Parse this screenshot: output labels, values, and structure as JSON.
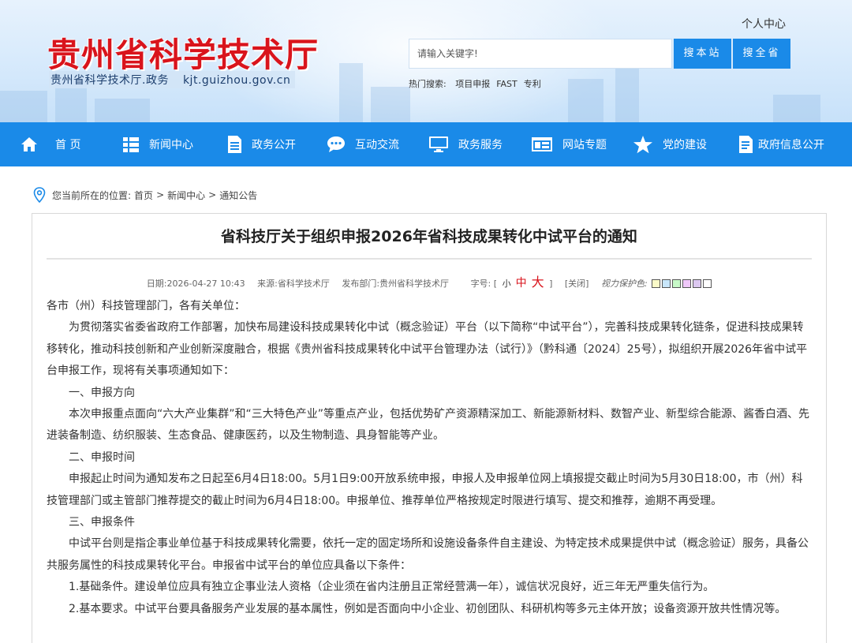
{
  "header": {
    "site_title": "贵州省科学技术厅",
    "site_subtitle_cn": "贵州省科学技术厅.政务",
    "site_subtitle_domain": "kjt.guizhou.gov.cn",
    "user_center": "个人中心",
    "search_placeholder": "请输入关键字!",
    "search_site_label": "搜本站",
    "search_province_label": "搜全省",
    "hot_label": "热门搜索:",
    "hot_items": [
      "项目申报",
      "FAST",
      "专利"
    ]
  },
  "nav": {
    "items": [
      {
        "label": "首 页",
        "icon": "home-icon"
      },
      {
        "label": "新闻中心",
        "icon": "grid-list-icon"
      },
      {
        "label": "政务公开",
        "icon": "document-icon"
      },
      {
        "label": "互动交流",
        "icon": "chat-bubble-icon"
      },
      {
        "label": "政务服务",
        "icon": "monitor-icon"
      },
      {
        "label": "网站专题",
        "icon": "window-icon"
      },
      {
        "label": "党的建设",
        "icon": "star-icon"
      },
      {
        "label": "政府信息公开",
        "icon": "file-icon"
      }
    ]
  },
  "breadcrumb": {
    "prefix": "您当前所在的位置:",
    "items": [
      "首页",
      "新闻中心",
      "通知公告"
    ],
    "separator": ">"
  },
  "article": {
    "title": "省科技厅关于组织申报2026年省科技成果转化中试平台的通知",
    "meta": {
      "date": "日期:2026-04-27 10:43",
      "source": "来源:省科学技术厅",
      "department": "发布部门:贵州省科学技术厅",
      "font_label": "字号:",
      "font_open": "[",
      "font_small": "小",
      "font_mid": "中",
      "font_big": "大",
      "font_close": "]",
      "close_label": "[关闭]",
      "eye_label": "视力保护色:",
      "swatch_colors": [
        "#fafac8",
        "#c8e6fa",
        "#c8fac8",
        "#f0c8fa",
        "#dcc8f0",
        "#ffffff"
      ]
    },
    "paragraphs": [
      "各市（州）科技管理部门，各有关单位：",
      "为贯彻落实省委省政府工作部署，加快布局建设科技成果转化中试（概念验证）平台（以下简称“中试平台”），完善科技成果转化链条，促进科技成果转移转化，推动科技创新和产业创新深度融合，根据《贵州省科技成果转化中试平台管理办法（试行）》（黔科通〔2024〕25号），拟组织开展2026年省中试平台申报工作，现将有关事项通知如下：",
      "一、申报方向",
      "本次申报重点面向“六大产业集群”和“三大特色产业”等重点产业，包括优势矿产资源精深加工、新能源新材料、数智产业、新型综合能源、酱香白酒、先进装备制造、纺织服装、生态食品、健康医药，以及生物制造、具身智能等产业。",
      "二、申报时间",
      "申报起止时间为通知发布之日起至6月4日18:00。5月1日9:00开放系统申报，申报人及申报单位网上填报提交截止时间为5月30日18:00，市（州）科技管理部门或主管部门推荐提交的截止时间为6月4日18:00。申报单位、推荐单位严格按规定时限进行填写、提交和推荐，逾期不再受理。",
      "三、申报条件",
      "中试平台则是指企事业单位基于科技成果转化需要，依托一定的固定场所和设施设备条件自主建设、为特定技术成果提供中试（概念验证）服务，具备公共服务属性的科技成果转化平台。申报省中试平台的单位应具备以下条件：",
      "1.基础条件。建设单位应具有独立企事业法人资格（企业须在省内注册且正常经营满一年），诚信状况良好，近三年无严重失信行为。",
      "2.基本要求。中试平台要具备服务产业发展的基本属性，例如是否面向中小企业、初创团队、科研机构等多元主体开放；设备资源开放共性情况等。"
    ]
  },
  "colors": {
    "brand_blue": "#1a8ae8",
    "title_red": "#d9141c"
  }
}
